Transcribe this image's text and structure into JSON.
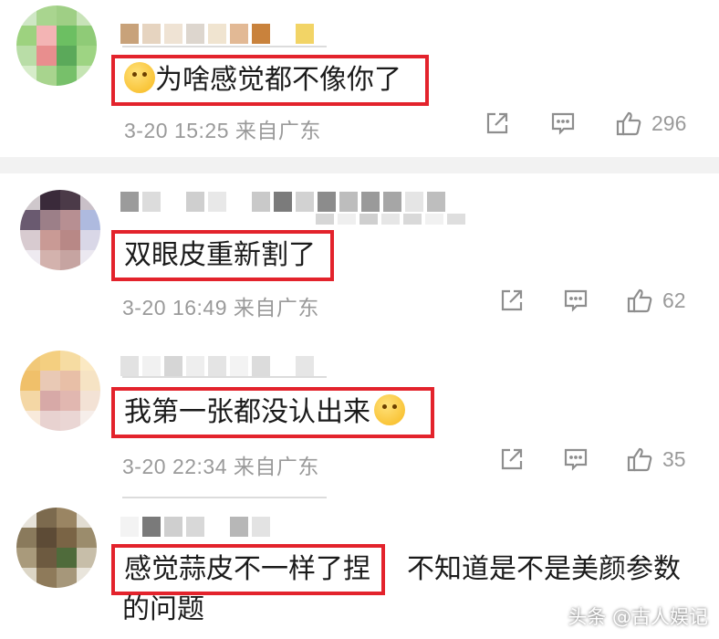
{
  "comments": [
    {
      "text": "为啥感觉都不像你了",
      "date": "3-20",
      "time": "15:25",
      "location": "来自广东",
      "likes": "296",
      "emoji": "crying-hug-emoji"
    },
    {
      "text": "双眼皮重新割了",
      "date": "3-20",
      "time": "16:49",
      "location": "来自广东",
      "likes": "62"
    },
    {
      "text": "我第一张都没认出来",
      "date": "3-20",
      "time": "22:34",
      "location": "来自广东",
      "likes": "35",
      "emoji": "laugh-cry-emoji"
    },
    {
      "text": "感觉蒜皮不一样了捏",
      "trail_1": "不知道是不是美颜参数",
      "trail_2": "的问题"
    }
  ],
  "watermark": "头条 @古人娱记",
  "colors": {
    "highlight_box": "#e3232c",
    "meta_text": "#9a9a9a",
    "separator": "#f2f2f2"
  }
}
